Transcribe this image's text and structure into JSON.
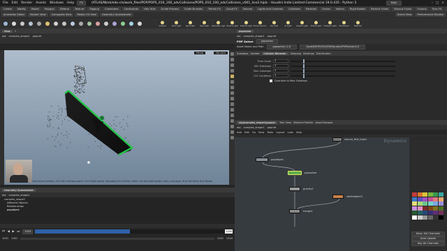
{
  "titlebar": {
    "menus": [
      "File",
      "Edit",
      "Render",
      "Assets",
      "Windows",
      "Help"
    ],
    "desktop": "FX",
    "path": "/ATLAS/Work/edu-cls/work_files/POP/POPS_010_100_advCollisions/POPS_010_100_advCollisions_v001_live2.hiplc - Houdini Indie Limited-Commercial 19.0.435 - Python 3",
    "main_label": "Main"
  },
  "shelf_tabs_left": [
    "Create",
    "Modify",
    "Model",
    "Polygon",
    "Deform",
    "Texture",
    "Rigging",
    "Characters",
    "Constraints",
    "Hair Utils",
    "Guide Process",
    "Guide Brushes",
    "Terrain FX",
    "Cloud FX",
    "Volume"
  ],
  "shelf_tabs_right": [
    "Lights and Cameras",
    "Collisions",
    "Particles",
    "Grains",
    "Vellum",
    "Rigid Bodies",
    "Particle Fluids",
    "Viscous Fluids",
    "Oceans",
    "Pyro FX",
    "FEM",
    "Wires",
    "Crowds",
    "Drive Simulation"
  ],
  "shelf_tabs_row2": [
    "Animation Editor",
    "Render View",
    "Composite View",
    "Motion FX View",
    "Geometry Spreadsheet"
  ],
  "shelf_tabs_row2_right": [
    "Scene View",
    "Performance Monitor"
  ],
  "tool_icons": [
    "box",
    "sphere",
    "tube",
    "torus",
    "grid",
    "null",
    "line",
    "circle",
    "curve",
    "draw-curve",
    "path",
    "spray-paint",
    "font",
    "platonic",
    "l-system",
    "metaball",
    "file"
  ],
  "right_tool_labels": [
    "Camera",
    "Point Light",
    "Spot Light",
    "Area Light",
    "Geometry Light",
    "Volume Light",
    "Distant Light",
    "Environment Light",
    "Sky Light",
    "GI Light",
    "Caustic Light",
    "Portal Light",
    "Ambient Light",
    "VR Camera",
    "Switcher"
  ],
  "left": {
    "tab": "View",
    "path": [
      "obj",
      "complex_shape1"
    ],
    "popnet": "popnet",
    "view_mode": "Persp",
    "camera": "No cam",
    "status": "Left mouse tumbles. Ctrl+Alt+Left box zooms. Ctrl+Right zooms. Spacebar-Ctrl-Left tilts. Hold L for alternate tumble, dolly, and zoom.    M or Alt+M for First Person"
  },
  "spreadsheet": {
    "tab": "Geometry Spreadsheet",
    "path": [
      "obj",
      "complex_shape1"
    ],
    "items": [
      "complex_shape1",
      "Affected Objects",
      "Relationships",
      "popobject"
    ]
  },
  "timeline": {
    "frame": "1024",
    "start": "1001",
    "end": "1240",
    "range_start": "1001",
    "range_end": "1240",
    "cursor_label": "1240",
    "progress": 0.48
  },
  "params": {
    "tab": "popsolver",
    "path": [
      "obj",
      "complex_shape1",
      "popnet"
    ],
    "node_type": "POP Solver",
    "node_name": "popsolver",
    "asset_name_label": "Asset Name and Path",
    "asset_name_value": "popsolver::2.0",
    "asset_path": "Opdef/DOP/SOLVER/Houdini/POPsolver/2.0",
    "subtabs": [
      "Substeps",
      "Update",
      "Collision Behavior",
      "Sleeping",
      "Bindings",
      "Distribution"
    ],
    "rows": [
      {
        "label": "Time Scale",
        "value": "1"
      },
      {
        "label": "Min Substeps",
        "value": "1"
      },
      {
        "label": "Max Substeps",
        "value": "1"
      },
      {
        "label": "CFL Condition",
        "value": "1"
      }
    ],
    "checkbox": "Quantize to Max Substeps"
  },
  "network": {
    "tabs": [
      "/obj/complex_shape1/popnet",
      "Tree View",
      "Material Palette",
      "Asset Browser"
    ],
    "path": [
      "obj",
      "complex_shape1",
      "popnet"
    ],
    "menus": [
      "Add",
      "Edit",
      "Go",
      "View",
      "Tools",
      "Layout",
      "Labs",
      "Help"
    ],
    "context_label": "Dynamics",
    "nodes": [
      {
        "name": "source_first_input",
        "color": "#7a7a7a"
      },
      {
        "name": "popobject",
        "color": "#8a8f96"
      },
      {
        "name": "popsolver",
        "color": "#5fae4e"
      },
      {
        "name": "gravity1",
        "color": "#9a9a9a"
      },
      {
        "name": "staticobject1",
        "color": "#c8804a"
      },
      {
        "name": "merge1",
        "color": "#8a8a8a"
      }
    ]
  },
  "palette_colors": [
    "#c43c3c",
    "#d8772e",
    "#d9c43d",
    "#79b63c",
    "#3b9a4e",
    "#38a6a0",
    "#3a7bc8",
    "#5b4fc2",
    "#a14fc2",
    "#c24f9a",
    "#e07b7b",
    "#e8a86a",
    "#e8dc78",
    "#a8d878",
    "#6cc48c",
    "#74d2cc",
    "#7aa8e0",
    "#9a8fe0",
    "#c88fe0",
    "#e08fc4",
    "#7a2a2a",
    "#804518",
    "#7f7224",
    "#4d6f23",
    "#245a2f",
    "#22625f",
    "#23497a",
    "#362f74",
    "#5f2f74",
    "#74305c",
    "#ffffff",
    "#cccccc",
    "#999999",
    "#666666",
    "#333333",
    "#000000"
  ],
  "side_buttons": {
    "keys": "Keys: Sel Channels",
    "auto": "Auto Update",
    "all": "Key All Channels"
  }
}
